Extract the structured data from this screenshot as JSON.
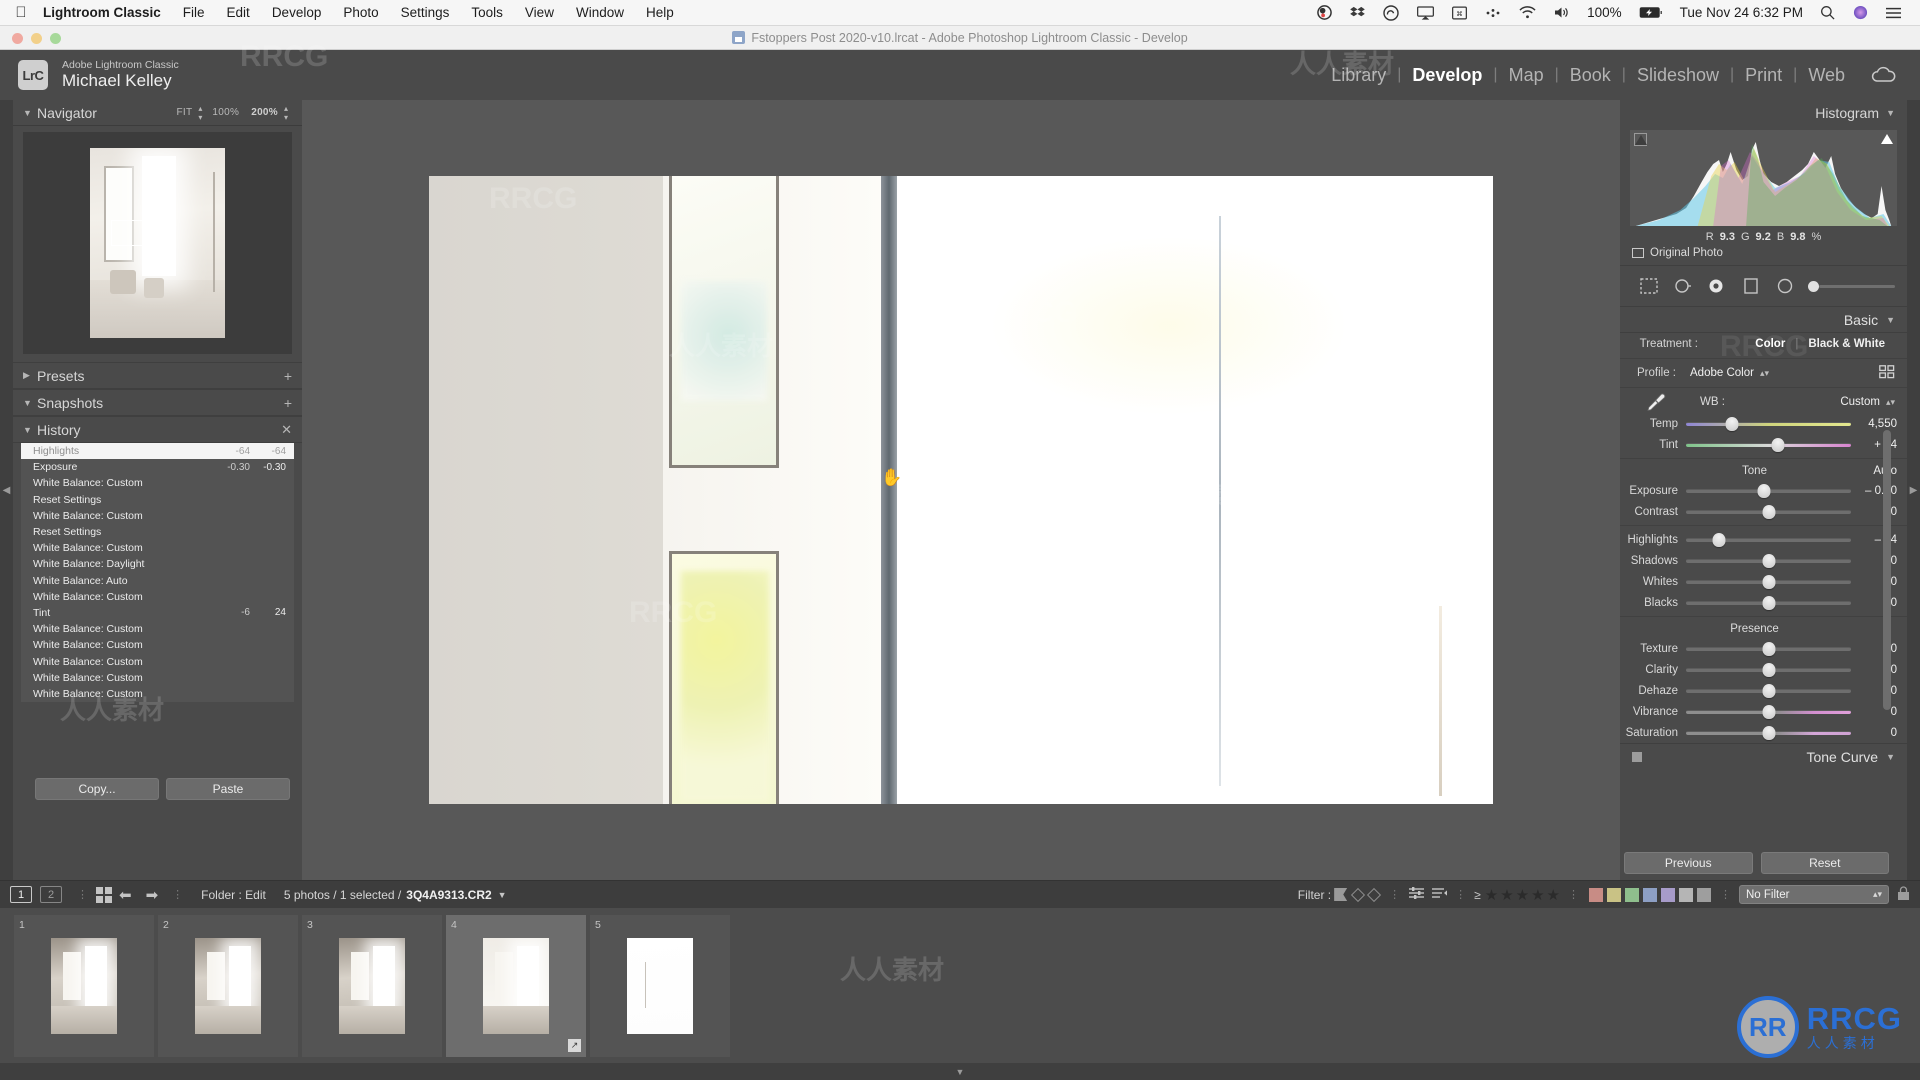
{
  "menubar": {
    "apple_icon": "apple-icon",
    "app_name": "Lightroom Classic",
    "items": [
      "File",
      "Edit",
      "Develop",
      "Photo",
      "Settings",
      "Tools",
      "View",
      "Window",
      "Help"
    ],
    "status_icons": [
      "obs-icon",
      "dropbox-icon",
      "creative-cloud-icon",
      "airplay-icon",
      "screenshot-icon",
      "more-icon",
      "wifi-icon",
      "volume-icon"
    ],
    "battery_percent": "100%",
    "battery_icon": "battery-charging-icon",
    "datetime": "Tue Nov 24  6:32 PM",
    "search_icon": "search-icon",
    "siri_icon": "siri-icon",
    "control_center_icon": "control-center-icon"
  },
  "titlebar": {
    "title": "Fstoppers Post 2020-v10.lrcat - Adobe Photoshop Lightroom Classic - Develop",
    "doc_icon": "catalog-file-icon"
  },
  "identity": {
    "badge": "LrC",
    "product": "Adobe Lightroom Classic",
    "user": "Michael Kelley",
    "modules": [
      "Library",
      "Develop",
      "Map",
      "Book",
      "Slideshow",
      "Print",
      "Web"
    ],
    "active_module": "Develop",
    "cloud_icon": "cloud-sync-icon"
  },
  "left_panel": {
    "navigator": {
      "title": "Navigator",
      "zoom_options": [
        "FIT",
        "100%",
        "200%"
      ],
      "active_zoom": "200%",
      "disclosure_icon": "triangle-down-icon"
    },
    "presets": {
      "title": "Presets",
      "disclosure_icon": "triangle-right-icon",
      "add_icon": "plus-icon"
    },
    "snapshots": {
      "title": "Snapshots",
      "disclosure_icon": "triangle-down-icon",
      "add_icon": "plus-icon"
    },
    "history": {
      "title": "History",
      "disclosure_icon": "triangle-down-icon",
      "clear_icon": "x-icon",
      "items": [
        {
          "name": "Highlights",
          "delta": "-64",
          "value": "-64",
          "selected": true
        },
        {
          "name": "Exposure",
          "delta": "-0.30",
          "value": "-0.30",
          "selected": false
        },
        {
          "name": "White Balance: Custom",
          "delta": "",
          "value": "",
          "selected": false
        },
        {
          "name": "Reset Settings",
          "delta": "",
          "value": "",
          "selected": false
        },
        {
          "name": "White Balance: Custom",
          "delta": "",
          "value": "",
          "selected": false
        },
        {
          "name": "Reset Settings",
          "delta": "",
          "value": "",
          "selected": false
        },
        {
          "name": "White Balance: Custom",
          "delta": "",
          "value": "",
          "selected": false
        },
        {
          "name": "White Balance: Daylight",
          "delta": "",
          "value": "",
          "selected": false
        },
        {
          "name": "White Balance: Auto",
          "delta": "",
          "value": "",
          "selected": false
        },
        {
          "name": "White Balance: Custom",
          "delta": "",
          "value": "",
          "selected": false
        },
        {
          "name": "Tint",
          "delta": "-6",
          "value": "24",
          "selected": false
        },
        {
          "name": "White Balance: Custom",
          "delta": "",
          "value": "",
          "selected": false
        },
        {
          "name": "White Balance: Custom",
          "delta": "",
          "value": "",
          "selected": false
        },
        {
          "name": "White Balance: Custom",
          "delta": "",
          "value": "",
          "selected": false
        },
        {
          "name": "White Balance: Custom",
          "delta": "",
          "value": "",
          "selected": false
        },
        {
          "name": "White Balance: Custom",
          "delta": "",
          "value": "",
          "selected": false
        }
      ]
    },
    "copy_label": "Copy...",
    "paste_label": "Paste"
  },
  "right_panel": {
    "histogram": {
      "title": "Histogram",
      "disclosure_icon": "triangle-down-icon",
      "shadow_clip_icon": "shadow-clipping-icon",
      "highlight_clip_icon": "highlight-clipping-icon",
      "r_label": "R",
      "r_value": "9.3",
      "g_label": "G",
      "g_value": "9.2",
      "b_label": "B",
      "b_value": "9.8",
      "percent": "%",
      "original_photo": "Original Photo"
    },
    "tools": [
      "crop-overlay-icon",
      "spot-removal-icon",
      "red-eye-icon",
      "graduated-filter-icon",
      "radial-filter-icon",
      "adjustment-brush-icon"
    ],
    "active_tool": "red-eye-icon",
    "basic": {
      "title": "Basic",
      "disclosure_icon": "triangle-down-icon",
      "treatment_label": "Treatment :",
      "treatment_options": [
        "Color",
        "Black & White"
      ],
      "treatment_active": "Color",
      "profile_label": "Profile :",
      "profile_value": "Adobe Color",
      "profile_stepper_icon": "stepper-icon",
      "profile_browser_icon": "profile-browser-icon",
      "eyedropper_icon": "white-balance-eyedropper-icon",
      "wb_label": "WB :",
      "wb_value": "Custom",
      "wb_stepper_icon": "stepper-icon",
      "wb_sliders": [
        {
          "label": "Temp",
          "value": "4,550",
          "pos": 28,
          "type": "temp"
        },
        {
          "label": "Tint",
          "value": "+ 24",
          "pos": 56,
          "type": "tint"
        }
      ],
      "tone_label": "Tone",
      "auto_label": "Auto",
      "tone_sliders": [
        {
          "label": "Exposure",
          "value": "– 0.30",
          "pos": 47
        },
        {
          "label": "Contrast",
          "value": "0",
          "pos": 50
        }
      ],
      "tone_sliders2": [
        {
          "label": "Highlights",
          "value": "– 64",
          "pos": 20
        },
        {
          "label": "Shadows",
          "value": "0",
          "pos": 50
        },
        {
          "label": "Whites",
          "value": "0",
          "pos": 50
        },
        {
          "label": "Blacks",
          "value": "0",
          "pos": 50
        }
      ],
      "presence_label": "Presence",
      "presence_sliders": [
        {
          "label": "Texture",
          "value": "0",
          "pos": 50
        },
        {
          "label": "Clarity",
          "value": "0",
          "pos": 50
        },
        {
          "label": "Dehaze",
          "value": "0",
          "pos": 50
        }
      ],
      "presence_sliders2": [
        {
          "label": "Vibrance",
          "value": "0",
          "pos": 50,
          "type": "vibrance"
        },
        {
          "label": "Saturation",
          "value": "0",
          "pos": 50,
          "type": "saturation"
        }
      ]
    },
    "tone_curve": {
      "title": "Tone Curve",
      "disclosure_icon": "triangle-down-icon",
      "toggle_icon": "panel-switch-icon"
    },
    "previous_label": "Previous",
    "reset_label": "Reset"
  },
  "toolbar": {
    "screen1": "1",
    "screen2": "2",
    "grid_icon": "grid-view-icon",
    "prev_icon": "arrow-left-icon",
    "next_icon": "arrow-right-icon",
    "source_label": "Folder : Edit",
    "count_label": "5 photos / 1 selected /",
    "filename": "3Q4A9313.CR2",
    "dropdown_icon": "chevron-down-icon",
    "filter_label": "Filter :",
    "flag_icons": [
      "flag-picked-icon",
      "flag-unflagged-icon",
      "flag-rejected-icon"
    ],
    "sort_icons": [
      "attribute-filter-icon",
      "metadata-filter-icon"
    ],
    "rating_prefix": "≥",
    "stars": 5,
    "color_labels": [
      "#c88c85",
      "#c9c285",
      "#8fbf8d",
      "#8d9fc4",
      "#a79bc9",
      "#b5b5b5",
      "#9e9e9e"
    ],
    "filter_preset": "No Filter",
    "filter_stepper_icon": "stepper-icon",
    "lock_icon": "filter-lock-icon"
  },
  "filmstrip": {
    "thumbnails": [
      {
        "num": "1",
        "selected": false,
        "style": "dim",
        "badge": ""
      },
      {
        "num": "2",
        "selected": false,
        "style": "dim",
        "badge": ""
      },
      {
        "num": "3",
        "selected": false,
        "style": "mid",
        "badge": ""
      },
      {
        "num": "4",
        "selected": true,
        "style": "bright",
        "badge": "edit-badge-icon"
      },
      {
        "num": "5",
        "selected": false,
        "style": "white",
        "badge": ""
      }
    ],
    "collapse_icon": "triangle-down-icon"
  },
  "watermarks": {
    "brand": "RRCG",
    "cjk": "人人素材",
    "logo_main": "RRCG",
    "logo_sub": "人人素材",
    "logo_mark": "RR",
    "accent": "#2b6fd4"
  }
}
